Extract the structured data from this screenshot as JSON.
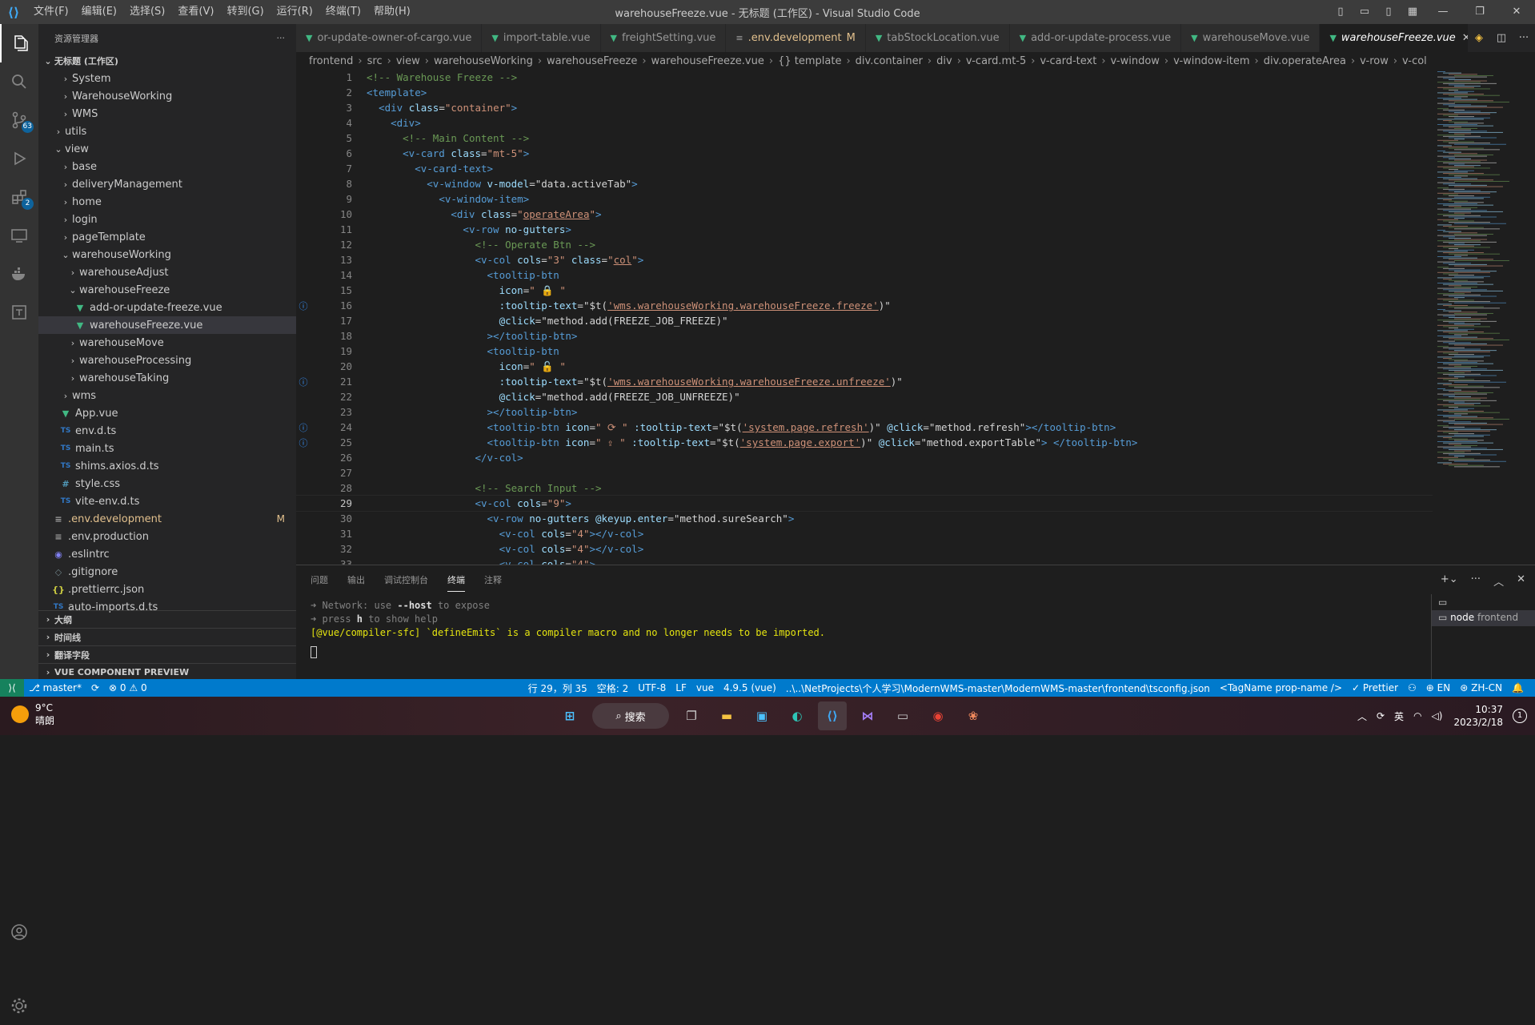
{
  "titlebar": {
    "menu": [
      "文件(F)",
      "编辑(E)",
      "选择(S)",
      "查看(V)",
      "转到(G)",
      "运行(R)",
      "终端(T)",
      "帮助(H)"
    ],
    "title": "warehouseFreeze.vue - 无标题 (工作区) - Visual Studio Code"
  },
  "activity": {
    "source_control_badge": "63",
    "extensions_badge": "2"
  },
  "sidebar": {
    "header": "资源管理器",
    "workspace": "无标题 (工作区)",
    "tree": [
      {
        "label": "System",
        "indent": 2,
        "type": "folder",
        "open": false
      },
      {
        "label": "WarehouseWorking",
        "indent": 2,
        "type": "folder",
        "open": false
      },
      {
        "label": "WMS",
        "indent": 2,
        "type": "folder",
        "open": false
      },
      {
        "label": "utils",
        "indent": 1,
        "type": "folder",
        "open": false
      },
      {
        "label": "view",
        "indent": 1,
        "type": "folder",
        "open": true
      },
      {
        "label": "base",
        "indent": 2,
        "type": "folder",
        "open": false
      },
      {
        "label": "deliveryManagement",
        "indent": 2,
        "type": "folder",
        "open": false
      },
      {
        "label": "home",
        "indent": 2,
        "type": "folder",
        "open": false
      },
      {
        "label": "login",
        "indent": 2,
        "type": "folder",
        "open": false
      },
      {
        "label": "pageTemplate",
        "indent": 2,
        "type": "folder",
        "open": false
      },
      {
        "label": "warehouseWorking",
        "indent": 2,
        "type": "folder",
        "open": true
      },
      {
        "label": "warehouseAdjust",
        "indent": 3,
        "type": "folder",
        "open": false
      },
      {
        "label": "warehouseFreeze",
        "indent": 3,
        "type": "folder",
        "open": true
      },
      {
        "label": "add-or-update-freeze.vue",
        "indent": 4,
        "type": "vue"
      },
      {
        "label": "warehouseFreeze.vue",
        "indent": 4,
        "type": "vue",
        "selected": true
      },
      {
        "label": "warehouseMove",
        "indent": 3,
        "type": "folder",
        "open": false
      },
      {
        "label": "warehouseProcessing",
        "indent": 3,
        "type": "folder",
        "open": false
      },
      {
        "label": "warehouseTaking",
        "indent": 3,
        "type": "folder",
        "open": false
      },
      {
        "label": "wms",
        "indent": 2,
        "type": "folder",
        "open": false
      },
      {
        "label": "App.vue",
        "indent": 2,
        "type": "vue"
      },
      {
        "label": "env.d.ts",
        "indent": 2,
        "type": "ts"
      },
      {
        "label": "main.ts",
        "indent": 2,
        "type": "ts"
      },
      {
        "label": "shims.axios.d.ts",
        "indent": 2,
        "type": "ts"
      },
      {
        "label": "style.css",
        "indent": 2,
        "type": "css"
      },
      {
        "label": "vite-env.d.ts",
        "indent": 2,
        "type": "ts"
      },
      {
        "label": ".env.development",
        "indent": 1,
        "type": "env",
        "modified": "M"
      },
      {
        "label": ".env.production",
        "indent": 1,
        "type": "env"
      },
      {
        "label": ".eslintrc",
        "indent": 1,
        "type": "esl"
      },
      {
        "label": ".gitignore",
        "indent": 1,
        "type": "git"
      },
      {
        "label": ".prettierrc.json",
        "indent": 1,
        "type": "json"
      },
      {
        "label": "auto-imports.d.ts",
        "indent": 1,
        "type": "ts"
      }
    ],
    "sections": [
      "大纲",
      "时间线",
      "翻译字段",
      "VUE COMPONENT PREVIEW"
    ]
  },
  "tabs": [
    {
      "label": "or-update-owner-of-cargo.vue",
      "icon": "vue"
    },
    {
      "label": "import-table.vue",
      "icon": "vue"
    },
    {
      "label": "freightSetting.vue",
      "icon": "vue"
    },
    {
      "label": ".env.development",
      "icon": "env",
      "modified": "M"
    },
    {
      "label": "tabStockLocation.vue",
      "icon": "vue"
    },
    {
      "label": "add-or-update-process.vue",
      "icon": "vue"
    },
    {
      "label": "warehouseMove.vue",
      "icon": "vue"
    },
    {
      "label": "warehouseFreeze.vue",
      "icon": "vue",
      "active": true
    }
  ],
  "breadcrumb": [
    "frontend",
    "src",
    "view",
    "warehouseWorking",
    "warehouseFreeze",
    "warehouseFreeze.vue",
    "{} template",
    "div.container",
    "div",
    "v-card.mt-5",
    "v-card-text",
    "v-window",
    "v-window-item",
    "div.operateArea",
    "v-row",
    "v-col"
  ],
  "editor": {
    "current_line": 29,
    "lines": [
      {
        "n": 1,
        "html": "<span class='cm'>&lt;!-- Warehouse Freeze --&gt;</span>"
      },
      {
        "n": 2,
        "html": "<span class='tg'>&lt;template&gt;</span>"
      },
      {
        "n": 3,
        "html": "  <span class='tg'>&lt;div</span> <span class='at'>class</span>=<span class='st'>\"container\"</span><span class='tg'>&gt;</span>"
      },
      {
        "n": 4,
        "html": "    <span class='tg'>&lt;div&gt;</span>"
      },
      {
        "n": 5,
        "html": "      <span class='cm'>&lt;!-- Main Content --&gt;</span>"
      },
      {
        "n": 6,
        "html": "      <span class='tg'>&lt;v-card</span> <span class='at'>class</span>=<span class='st'>\"mt-5\"</span><span class='tg'>&gt;</span>"
      },
      {
        "n": 7,
        "html": "        <span class='tg'>&lt;v-card-text&gt;</span>"
      },
      {
        "n": 8,
        "html": "          <span class='tg'>&lt;v-window</span> <span class='at'>v-model</span>=<span class='ex'>\"data.activeTab\"</span><span class='tg'>&gt;</span>"
      },
      {
        "n": 9,
        "html": "            <span class='tg'>&lt;v-window-item&gt;</span>"
      },
      {
        "n": 10,
        "html": "              <span class='tg'>&lt;div</span> <span class='at'>class</span>=<span class='st'>\"<u>operateArea</u>\"</span><span class='tg'>&gt;</span>"
      },
      {
        "n": 11,
        "html": "                <span class='tg'>&lt;v-row</span> <span class='at'>no-gutters</span><span class='tg'>&gt;</span>"
      },
      {
        "n": 12,
        "html": "                  <span class='cm'>&lt;!-- Operate Btn --&gt;</span>"
      },
      {
        "n": 13,
        "html": "                  <span class='tg'>&lt;v-col</span> <span class='at'>cols</span>=<span class='st'>\"3\"</span> <span class='at'>class</span>=<span class='st'>\"<u>col</u>\"</span><span class='tg'>&gt;</span>"
      },
      {
        "n": 14,
        "html": "                    <span class='tg'>&lt;tooltip-btn</span>"
      },
      {
        "n": 15,
        "html": "                      <span class='at'>icon</span>=<span class='st'>\" 🔒 \"</span>"
      },
      {
        "n": 16,
        "html": "                      <span class='at'>:tooltip-text</span>=<span class='ex'>\"$t(</span><span class='lk'>'wms.warehouseWorking.warehouseFreeze.freeze'</span><span class='ex'>)\"</span>",
        "info": true
      },
      {
        "n": 17,
        "html": "                      <span class='at'>@click</span>=<span class='ex'>\"method.add(FREEZE_JOB_FREEZE)\"</span>"
      },
      {
        "n": 18,
        "html": "                    <span class='tg'>&gt;&lt;/tooltip-btn&gt;</span>"
      },
      {
        "n": 19,
        "html": "                    <span class='tg'>&lt;tooltip-btn</span>"
      },
      {
        "n": 20,
        "html": "                      <span class='at'>icon</span>=<span class='st'>\" 🔓 \"</span>"
      },
      {
        "n": 21,
        "html": "                      <span class='at'>:tooltip-text</span>=<span class='ex'>\"$t(</span><span class='lk'>'wms.warehouseWorking.warehouseFreeze.unfreeze'</span><span class='ex'>)\"</span>",
        "info": true
      },
      {
        "n": 22,
        "html": "                      <span class='at'>@click</span>=<span class='ex'>\"method.add(FREEZE_JOB_UNFREEZE)\"</span>"
      },
      {
        "n": 23,
        "html": "                    <span class='tg'>&gt;&lt;/tooltip-btn&gt;</span>"
      },
      {
        "n": 24,
        "html": "                    <span class='tg'>&lt;tooltip-btn</span> <span class='at'>icon</span>=<span class='st'>\" ⟳ \"</span> <span class='at'>:tooltip-text</span>=<span class='ex'>\"$t(</span><span class='lk'>'system.page.refresh'</span><span class='ex'>)\"</span> <span class='at'>@click</span>=<span class='ex'>\"method.refresh\"</span><span class='tg'>&gt;&lt;/tooltip-btn&gt;</span>",
        "info": true
      },
      {
        "n": 25,
        "html": "                    <span class='tg'>&lt;tooltip-btn</span> <span class='at'>icon</span>=<span class='st'>\" ⇪ \"</span> <span class='at'>:tooltip-text</span>=<span class='ex'>\"$t(</span><span class='lk'>'system.page.export'</span><span class='ex'>)\"</span> <span class='at'>@click</span>=<span class='ex'>\"method.exportTable\"</span><span class='tg'>&gt;</span> <span class='tg'>&lt;/tooltip-btn&gt;</span>",
        "info": true
      },
      {
        "n": 26,
        "html": "                  <span class='tg'>&lt;/v-col&gt;</span>"
      },
      {
        "n": 27,
        "html": ""
      },
      {
        "n": 28,
        "html": "                  <span class='cm'>&lt;!-- Search Input --&gt;</span>"
      },
      {
        "n": 29,
        "html": "                  <span class='tg'>&lt;v-col</span> <span class='at'>cols</span>=<span class='st'>\"9\"</span><span class='tg'>&gt;</span>"
      },
      {
        "n": 30,
        "html": "                    <span class='tg'>&lt;v-row</span> <span class='at'>no-gutters</span> <span class='at'>@keyup.enter</span>=<span class='ex'>\"method.sureSearch\"</span><span class='tg'>&gt;</span>"
      },
      {
        "n": 31,
        "html": "                      <span class='tg'>&lt;v-col</span> <span class='at'>cols</span>=<span class='st'>\"4\"</span><span class='tg'>&gt;&lt;/v-col&gt;</span>"
      },
      {
        "n": 32,
        "html": "                      <span class='tg'>&lt;v-col</span> <span class='at'>cols</span>=<span class='st'>\"4\"</span><span class='tg'>&gt;&lt;/v-col&gt;</span>"
      },
      {
        "n": 33,
        "html": "                      <span class='tg'>&lt;v-col</span> <span class='at'>cols</span>=<span class='st'>\"4\"</span><span class='tg'>&gt;</span>"
      }
    ]
  },
  "panel": {
    "tabs": [
      "问题",
      "输出",
      "调试控制台",
      "终端",
      "注释"
    ],
    "active_tab": "终端",
    "terminal": {
      "line1_a": "➜  Network: use ",
      "line1_b": "--host",
      "line1_c": " to expose",
      "line2_a": "➜  press ",
      "line2_b": "h",
      "line2_c": " to show help",
      "line3_a": "[@vue/compiler-sfc]",
      "line3_b": " `defineEmits` is a compiler macro and no longer needs to be imported."
    },
    "term_list_item": "node",
    "term_list_cwd": "frontend"
  },
  "statusbar": {
    "branch": "master*",
    "errors": "⊗ 0 ⚠ 0",
    "position": "行 29，列 35",
    "spaces": "空格: 2",
    "encoding": "UTF-8",
    "eol": "LF",
    "lang": "vue",
    "version": "4.9.5 (vue)",
    "tsconfig": "..\\..\\NetProjects\\个人学习\\ModernWMS-master\\ModernWMS-master\\frontend\\tsconfig.json",
    "tagname": "<TagName prop-name />",
    "prettier": "✓ Prettier",
    "en": "EN",
    "zh": "ZH-CN"
  },
  "taskbar": {
    "temp": "9°C",
    "weather": "晴朗",
    "search": "搜索",
    "ime": "英",
    "time": "10:37",
    "date": "2023/2/18",
    "notif": "1"
  },
  "colors": {
    "accent": "#007acc",
    "vue": "#41b883",
    "statusbar": "#007acc"
  }
}
